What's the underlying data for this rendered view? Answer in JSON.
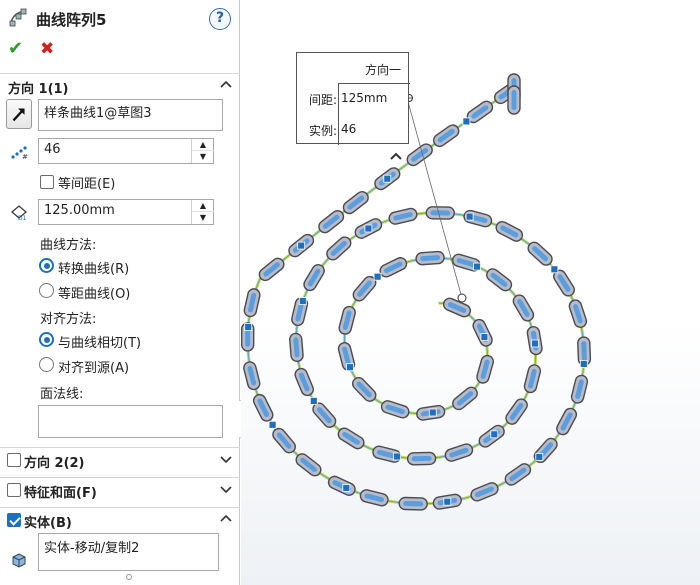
{
  "property_manager": {
    "title": "曲线阵列5",
    "help_label": "?",
    "ok_label": "✔",
    "cancel_label": "✖"
  },
  "direction1": {
    "title": "方向 1(1)",
    "curve_value": "样条曲线1@草图3",
    "instances_value": "46",
    "equal_spacing_label": "等间距(E)",
    "equal_spacing_checked": false,
    "spacing_value": "125.00mm",
    "curve_method_label": "曲线方法:",
    "curve_methods": [
      {
        "label": "转换曲线(R)",
        "selected": true
      },
      {
        "label": "等距曲线(O)",
        "selected": false
      }
    ],
    "align_method_label": "对齐方法:",
    "align_methods": [
      {
        "label": "与曲线相切(T)",
        "selected": true
      },
      {
        "label": "对齐到源(A)",
        "selected": false
      }
    ],
    "normal_face_label": "面法线:",
    "normal_face_value": ""
  },
  "direction2": {
    "title": "方向 2(2)",
    "checked": false
  },
  "features_faces": {
    "title": "特征和面(F)",
    "checked": false
  },
  "bodies": {
    "title": "实体(B)",
    "checked": true,
    "value": "实体-移动/复制2"
  },
  "callout": {
    "title": "方向一",
    "spacing_label": "间距:",
    "spacing_value": "125mm",
    "instances_label": "实例:",
    "instances_value": "46"
  },
  "colors": {
    "accent": "#1e6fc0",
    "curve": "#c8d84a",
    "curve_highlight": "#4aa8e0",
    "link_fill": "#5b9ee0",
    "link_outline": "#4a4a55",
    "point_fill": "#1e6fc0"
  },
  "icons": [
    "curve-pattern-icon",
    "help-icon",
    "check-icon",
    "close-icon",
    "chevron-up-icon",
    "chevron-down-icon",
    "direction-arrow-icon",
    "instances-icon",
    "spacing-icon",
    "body-icon"
  ]
}
